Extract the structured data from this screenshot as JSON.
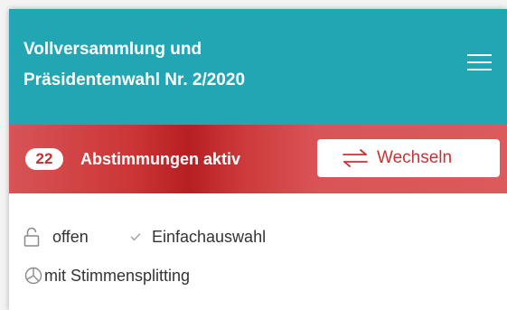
{
  "header": {
    "title_line1": "Vollversammlung und",
    "title_line2": "Präsidentenwahl Nr. 2/2020",
    "menu_icon": "hamburger-icon"
  },
  "alert": {
    "count": "22",
    "label": "Abstimmungen aktiv",
    "switch_label": "Wechseln",
    "switch_icon": "swap-arrows-icon"
  },
  "info": {
    "status_icon": "unlock-icon",
    "status": "offen",
    "mode_icon": "check-icon",
    "mode": "Einfachauswahl",
    "split_icon": "vote-split-icon",
    "split": "mit Stimmensplitting"
  },
  "colors": {
    "header_bg": "#23a6b4",
    "alert_bg": "#d95456",
    "alert_accent": "#c73335"
  }
}
